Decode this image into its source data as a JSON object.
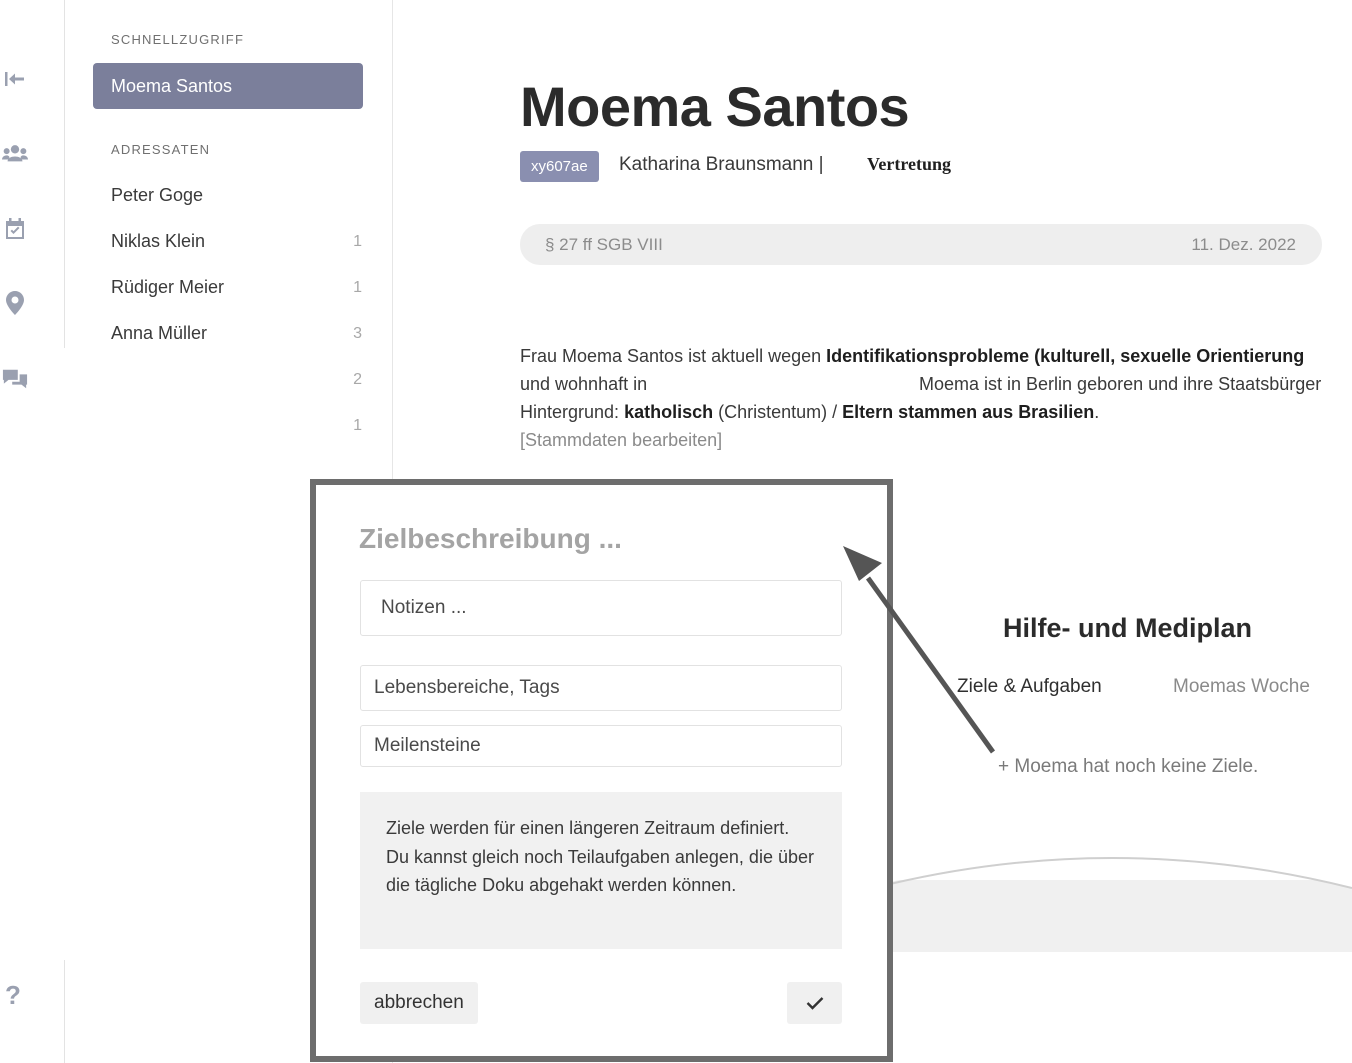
{
  "sidebar": {
    "quick_access_label": "SCHNELLZUGRIFF",
    "active_contact": "Moema Santos",
    "recipients_label": "ADRESSATEN",
    "contacts": [
      {
        "name": "Peter Goge",
        "count": ""
      },
      {
        "name": "Niklas Klein",
        "count": "1"
      },
      {
        "name": "Rüdiger Meier",
        "count": "1"
      },
      {
        "name": "Anna Müller",
        "count": "3"
      }
    ],
    "extra_counts": [
      "2",
      "1"
    ]
  },
  "profile": {
    "name": "Moema Santos",
    "id_tag": "xy607ae",
    "caseworker": "Katharina Braunsmann |",
    "role": "Vertretung",
    "law": "§ 27 ff SGB VIII",
    "date": "11. Dez. 2022",
    "description": {
      "l1_a": "Frau Moema Santos ist aktuell wegen ",
      "l1_b": "Identifikationsprobleme (kulturell, sexuelle Orientierung",
      "l2_a": "und wohnhaft in",
      "l2_b": "Moema ist in Berlin geboren und ihre Staatsbürger",
      "l3_a": "Hintergrund: ",
      "l3_b": "katholisch",
      "l3_c": " (Christentum) / ",
      "l3_d": "Eltern stammen aus Brasilien",
      "l3_e": ".",
      "edit_link": "[Stammdaten bearbeiten]"
    }
  },
  "plan": {
    "title": "Hilfe- und Mediplan",
    "tabs": [
      "Ziele & Aufgaben",
      "Moemas Woche"
    ],
    "no_goals": "+ Moema hat noch keine Ziele."
  },
  "modal": {
    "title_placeholder": "Zielbeschreibung ...",
    "notes_placeholder": "Notizen ...",
    "tags_placeholder": "Lebensbereiche, Tags",
    "milestones_placeholder": "Meilensteine",
    "hint": "Ziele werden für einen längeren Zeitraum definiert. Du kannst gleich noch Teilaufgaben anlegen, die über die tägliche Doku abgehakt werden können.",
    "cancel": "abbrechen",
    "confirm_icon": "check-icon"
  },
  "colors": {
    "accent": "#7b7f9b",
    "tag": "#8a8fb0",
    "modal_border": "#6d6d6d",
    "arrow": "#555555"
  }
}
